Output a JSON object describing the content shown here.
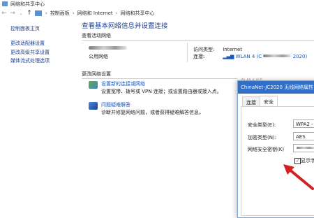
{
  "window": {
    "title": "网络和共享中心"
  },
  "addressbar": {
    "breadcrumbs": [
      "控制面板",
      "网络和 Internet",
      "网络和共享中心"
    ]
  },
  "sidebar": {
    "home": "控制面板主页",
    "items": [
      "更改适配器设置",
      "更改高级共享设置",
      "媒体流式处理选项"
    ]
  },
  "main": {
    "title": "查看基本网络信息并设置连接",
    "active_networks_label": "查看活动网络",
    "network_type": "公用网络",
    "access_type_label": "访问类型:",
    "access_type_value": "Internet",
    "connections_label": "连接:",
    "connection_value": "WLAN 4 (C",
    "connection_suffix": "2020)",
    "change_settings_label": "更改网络设置",
    "tasks": [
      {
        "link": "设置新的连接或网络",
        "desc": "设置宽带、拨号或 VPN 连接；或设置路由器或接入点。"
      },
      {
        "link": "问题疑难解答",
        "desc": "诊断并修复网络问题，或者获得疑难解答信息。"
      }
    ]
  },
  "dialog": {
    "ghost_title": "WLAN 4 状态",
    "title": "ChinaNet-JC2020 无线网络属性",
    "tabs": [
      "连接",
      "安全"
    ],
    "active_tab": 1,
    "fields": [
      {
        "label": "安全类型(E):",
        "value": "WPA2 -"
      },
      {
        "label": "加密类型(N):",
        "value": "AES"
      },
      {
        "label": "网络安全密钥(K)",
        "value": ""
      }
    ],
    "show_chars_label": "显示字",
    "show_chars_checked": true
  },
  "colors": {
    "accent": "#2f6fc8",
    "link": "#1a57b8",
    "heading": "#1f3f8f",
    "arrow": "#d42020"
  }
}
